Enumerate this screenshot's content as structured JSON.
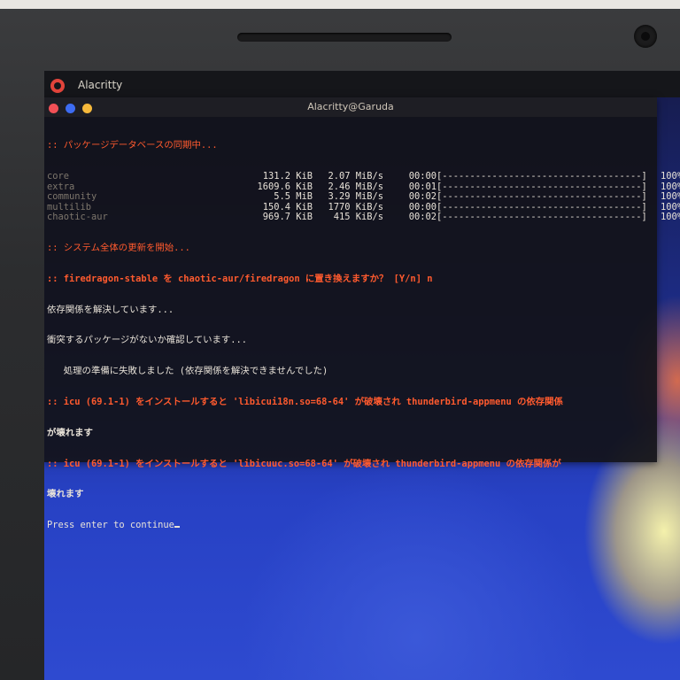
{
  "app": {
    "name": "Alacritty",
    "window_title": "Alacritty@Garuda"
  },
  "terminal": {
    "sync_header": ":: パッケージデータベースの同期中...",
    "repos": [
      {
        "name": "core",
        "size": "131.2 KiB",
        "rate": "2.07 MiB/s",
        "time": "00:00",
        "bar": "[------------------------------------]",
        "percent": "100%"
      },
      {
        "name": "extra",
        "size": "1609.6 KiB",
        "rate": "2.46 MiB/s",
        "time": "00:01",
        "bar": "[------------------------------------]",
        "percent": "100%"
      },
      {
        "name": "community",
        "size": "5.5 MiB",
        "rate": "3.29 MiB/s",
        "time": "00:02",
        "bar": "[------------------------------------]",
        "percent": "100%"
      },
      {
        "name": "multilib",
        "size": "150.4 KiB",
        "rate": "1770 KiB/s",
        "time": "00:00",
        "bar": "[------------------------------------]",
        "percent": "100%"
      },
      {
        "name": "chaotic-aur",
        "size": "969.7 KiB",
        "rate": "415 KiB/s",
        "time": "00:02",
        "bar": "[------------------------------------]",
        "percent": "100%"
      }
    ],
    "upgrade_header": ":: システム全体の更新を開始...",
    "replace_prompt": ":: firedragon-stable を chaotic-aur/firedragon に置き換えますか？ [Y/n] n",
    "resolving": "依存関係を解決しています...",
    "conflicts": "衝突するパッケージがないか確認しています...",
    "error_line": "   処理の準備に失敗しました (依存関係を解決できませんでした)",
    "dep_error_1a": ":: icu (69.1-1) をインストールすると 'libicui18n.so=68-64' が破壊され thunderbird-appmenu の依存関係",
    "dep_error_1b": "が壊れます",
    "dep_error_2a": ":: icu (69.1-1) をインストールすると 'libicuuc.so=68-64' が破壊され thunderbird-appmenu の依存関係が",
    "dep_error_2b": "壊れます",
    "press_enter": "Press enter to continue"
  },
  "colors": {
    "accent": "#ff5a2e",
    "terminal_text": "#e8e2d8",
    "wallpaper_blue": "#2741c4"
  }
}
